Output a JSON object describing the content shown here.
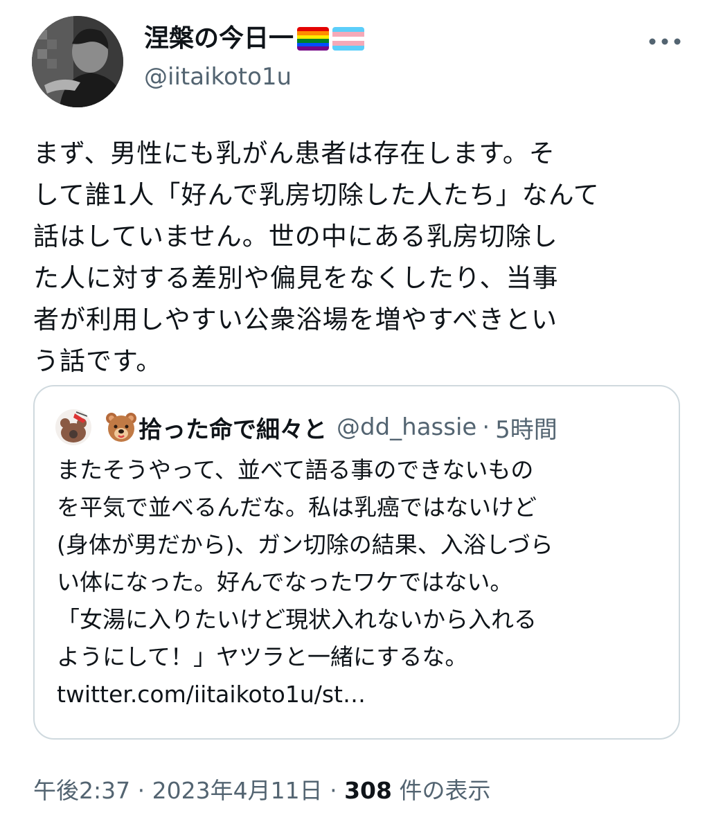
{
  "author": {
    "display_name": "涅槃の今日一",
    "handle": "@iitaikoto1u",
    "avatar_icon": "profile-photo-icon",
    "badges": [
      "rainbow-flag-icon",
      "transgender-flag-icon"
    ]
  },
  "more_icon": "more-horizontal-icon",
  "tweet": {
    "text": "まず、男性にも乳がん患者は存在します。そ\nして誰1人「好んで乳房切除した人たち」なんて\n話はしていません。世の中にある乳房切除し\nた人に対する差別や偏見をなくしたり、当事\n者が利用しやすい公衆浴場を増やすべきとい\nう話です。"
  },
  "quote": {
    "avatar_icon": "quote-author-avatar-icon",
    "emoji_icon": "bear-face-emoji-icon",
    "display_name": "拾った命で細々と",
    "handle": "@dd_hassie",
    "separator": "·",
    "time": "5時間",
    "text": "またそうやって、並べて語る事のできないもの\nを平気で並べるんだな。私は乳癌ではないけど\n(身体が男だから)、ガン切除の結果、入浴しづら\nい体になった。好んでなったワケではない。\n「女湯に入りたいけど現状入れないから入れる\nようにして！」ヤツラと一緒にするな。",
    "link": "twitter.com/iitaikoto1u/st…"
  },
  "meta": {
    "time": "午後2:37",
    "separator": "·",
    "date": "2023年4月11日",
    "views_count": "308",
    "views_label": "件の表示"
  },
  "colors": {
    "text_primary": "#0f1419",
    "text_secondary": "#536471",
    "card_border": "#cfd9de"
  }
}
